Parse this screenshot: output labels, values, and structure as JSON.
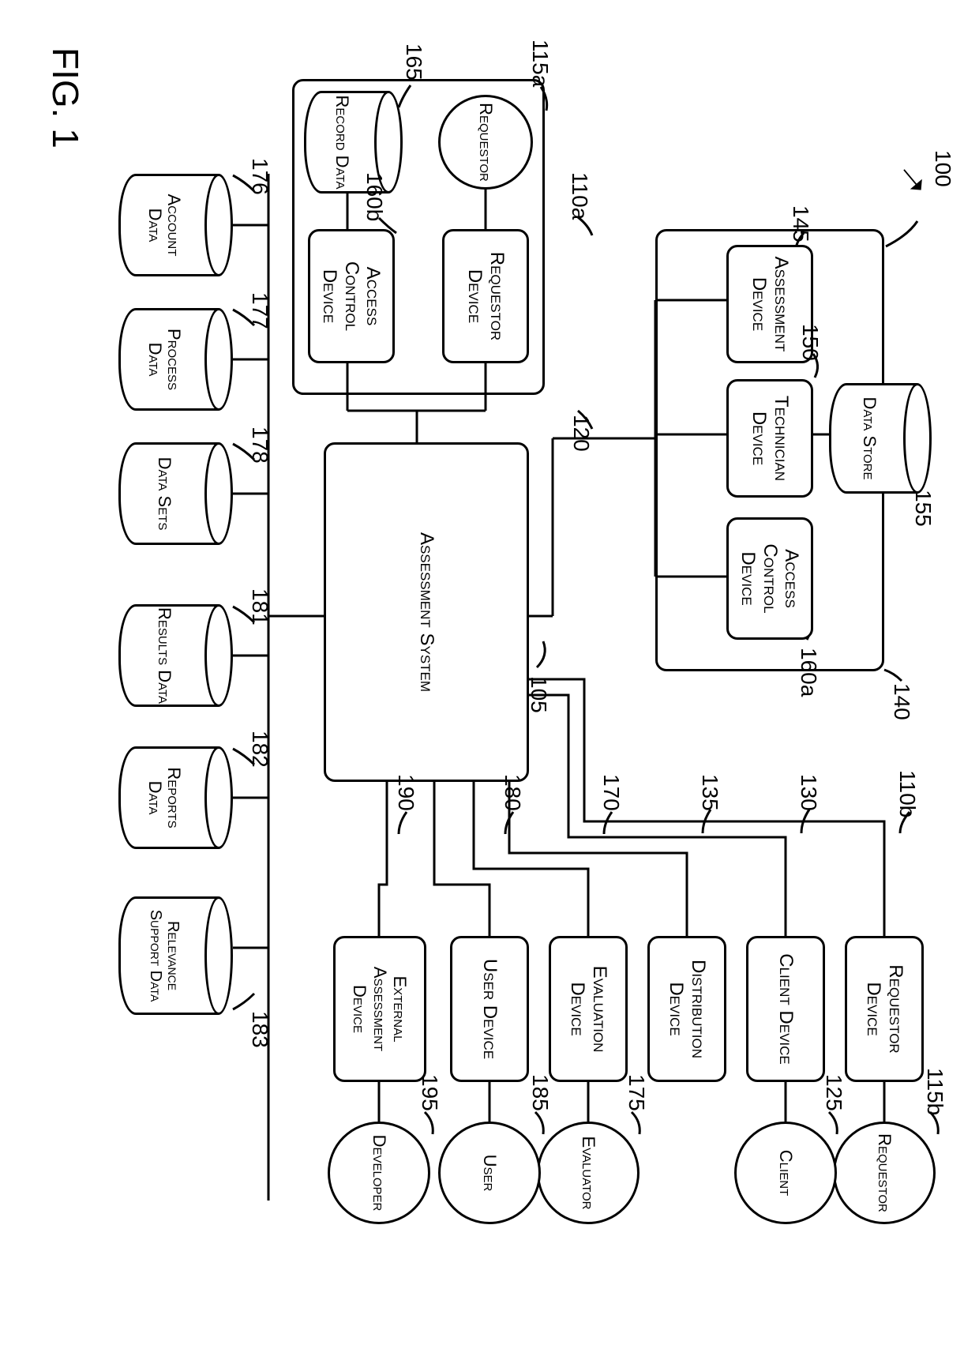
{
  "figure_label": "FIG. 1",
  "ref_100": "100",
  "boxes": {
    "assessment_system": "Assessment System",
    "assessment_device": "Assessment Device",
    "technician_device": "Technician Device",
    "access_control_a": "Access Control Device",
    "access_control_b": "Access Control Device",
    "requestor_device_a": "Requestor Device",
    "requestor_device_b": "Requestor Device",
    "client_device": "Client Device",
    "distribution_device": "Distribution Device",
    "evaluation_device": "Evaluation Device",
    "user_device": "User Device",
    "external_assessment_device": "External Assessment Device"
  },
  "actors": {
    "requestor_a": "Requestor",
    "requestor_b": "Requestor",
    "client": "Client",
    "evaluator": "Evaluator",
    "user": "User",
    "developer": "Developer"
  },
  "stores": {
    "data_store": "Data Store",
    "record_data": "Record Data",
    "account_data": "Account Data",
    "process_data": "Process Data",
    "data_sets": "Data Sets",
    "results_data": "Results Data",
    "reports_data": "Reports Data",
    "relevance_support_data": "Relevance Support Data"
  },
  "refs": {
    "r105": "105",
    "r110a": "110a",
    "r110b": "110b",
    "r115a": "115a",
    "r115b": "115b",
    "r120": "120",
    "r125": "125",
    "r130": "130",
    "r135": "135",
    "r140": "140",
    "r145": "145",
    "r150": "150",
    "r155": "155",
    "r160a": "160a",
    "r160b": "160b",
    "r165": "165",
    "r170": "170",
    "r175": "175",
    "r176": "176",
    "r177": "177",
    "r178": "178",
    "r180": "180",
    "r181": "181",
    "r182": "182",
    "r183": "183",
    "r185": "185",
    "r190": "190",
    "r195": "195"
  }
}
